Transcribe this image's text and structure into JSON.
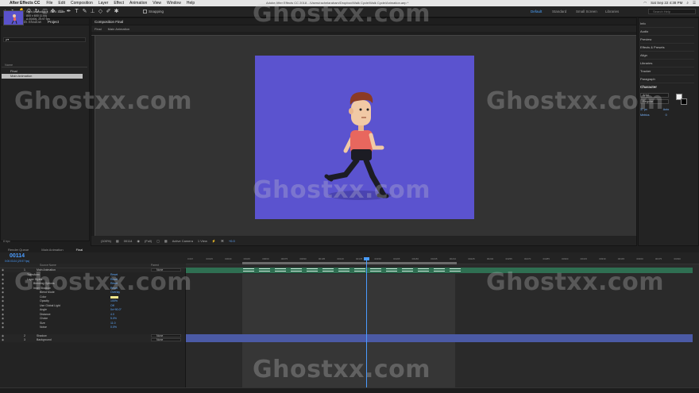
{
  "menu_bar": {
    "app_name": "After Effects CC",
    "items": [
      "File",
      "Edit",
      "Composition",
      "Layer",
      "Effect",
      "Animation",
      "View",
      "Window",
      "Help"
    ],
    "document_title": "Adobe After Effects CC 2018 - /Users/rachelaraham/Dropbox/Walk Cycle/Walk Cycle/Animation.aep *",
    "clock": "Sat Sep 22  4:38 PM"
  },
  "toolbar": {
    "snapping_label": "Snapping",
    "workspaces": [
      "Default",
      "Standard",
      "Small Screen",
      "Libraries"
    ],
    "active_workspace": "Default",
    "search_placeholder": "Search Help"
  },
  "project_panel": {
    "tabs": [
      "Effect Controls Shadow",
      "Project"
    ],
    "active_tab": "Project",
    "thumb_title": "Main Animation ▾ , used 1 time",
    "thumb_line2": "800 x 600 (1.00)",
    "thumb_line3": "Δ 00406, 29.97 fps",
    "search_placeholder": "ρ▾",
    "column_header": "Name",
    "items": [
      "Final",
      "Main Animation"
    ],
    "selected_item": "Main Animation",
    "footer": "8 bpc"
  },
  "viewer": {
    "tab_prefix": "Composition",
    "tab_name": "Final",
    "crumbs": [
      "Final",
      "Main Animation"
    ],
    "zoom": "(100%)",
    "timecode": "00114",
    "resolution": "(Full)",
    "camera": "Active Camera",
    "views": "1 View",
    "exposure": "+0.0"
  },
  "right_panel": {
    "items": [
      "Info",
      "Audio",
      "Preview",
      "Effects & Presets",
      "Align",
      "Libraries",
      "Tracker",
      "Paragraph"
    ],
    "character": {
      "title": "Character",
      "font": "Arial",
      "style": "Regular",
      "size": "37 px",
      "leading": "Auto",
      "tracking": "Metrics",
      "kerning": "0",
      "stroke": "px"
    }
  },
  "timeline": {
    "tabs": [
      "Render Queue",
      "Main Animation",
      "Final"
    ],
    "active_tab": "Final",
    "timecode": "00114",
    "timecode_sub": "0:00:03:24 (29.97 fps)",
    "columns": [
      "Source Name",
      "Parent"
    ],
    "rows": [
      {
        "name": "Main Animation",
        "indent": 1,
        "kind": "layer",
        "num": "1",
        "parent": "None"
      },
      {
        "name": "Transform",
        "indent": 2,
        "kind": "group",
        "val": "Reset"
      },
      {
        "name": "Layer Styles",
        "indent": 2,
        "kind": "group",
        "val": "Reset"
      },
      {
        "name": "Blending Options",
        "indent": 3,
        "kind": "group",
        "val": "Reset"
      },
      {
        "name": "Inner Shadow",
        "indent": 3,
        "kind": "group",
        "val": "Reset"
      },
      {
        "name": "Blend Mode",
        "indent": 4,
        "kind": "prop",
        "val": "Overlay"
      },
      {
        "name": "Color",
        "indent": 4,
        "kind": "prop",
        "val": ""
      },
      {
        "name": "Opacity",
        "indent": 4,
        "kind": "prop",
        "val": "100%"
      },
      {
        "name": "Use Global Light",
        "indent": 4,
        "kind": "prop",
        "val": "Off"
      },
      {
        "name": "Angle",
        "indent": 4,
        "kind": "prop",
        "val": "0x+90.0°"
      },
      {
        "name": "Distance",
        "indent": 4,
        "kind": "prop",
        "val": "4.0"
      },
      {
        "name": "Choke",
        "indent": 4,
        "kind": "prop",
        "val": "5.0%"
      },
      {
        "name": "Size",
        "indent": 4,
        "kind": "prop",
        "val": "11.0"
      },
      {
        "name": "Noise",
        "indent": 4,
        "kind": "prop",
        "val": "0.0%"
      },
      {
        "name": "Shadow",
        "indent": 1,
        "kind": "layer",
        "num": "2",
        "parent": "None"
      },
      {
        "name": "Background",
        "indent": 1,
        "kind": "layer",
        "num": "3",
        "parent": "None"
      }
    ],
    "ruler_ticks": [
      "0:00f",
      "00015",
      "00030",
      "00045",
      "00060",
      "00075",
      "00090",
      "00105",
      "00120",
      "00135",
      "00150",
      "00165",
      "00180",
      "00195",
      "00210",
      "00225",
      "00240",
      "00255",
      "00270",
      "00285",
      "00300",
      "00315",
      "00330",
      "00345",
      "00360",
      "00375",
      "00390"
    ],
    "toggle_label": "Toggle Switches / Modes"
  },
  "watermark": "Ghostxx.com",
  "colors": {
    "accent_blue": "#4a9cff",
    "comp_bg": "#5b53cf",
    "layer_green": "#2f6f52",
    "layer_blue": "#4b5aa5",
    "shirt": "#e8675e",
    "hair": "#8b3a24"
  }
}
